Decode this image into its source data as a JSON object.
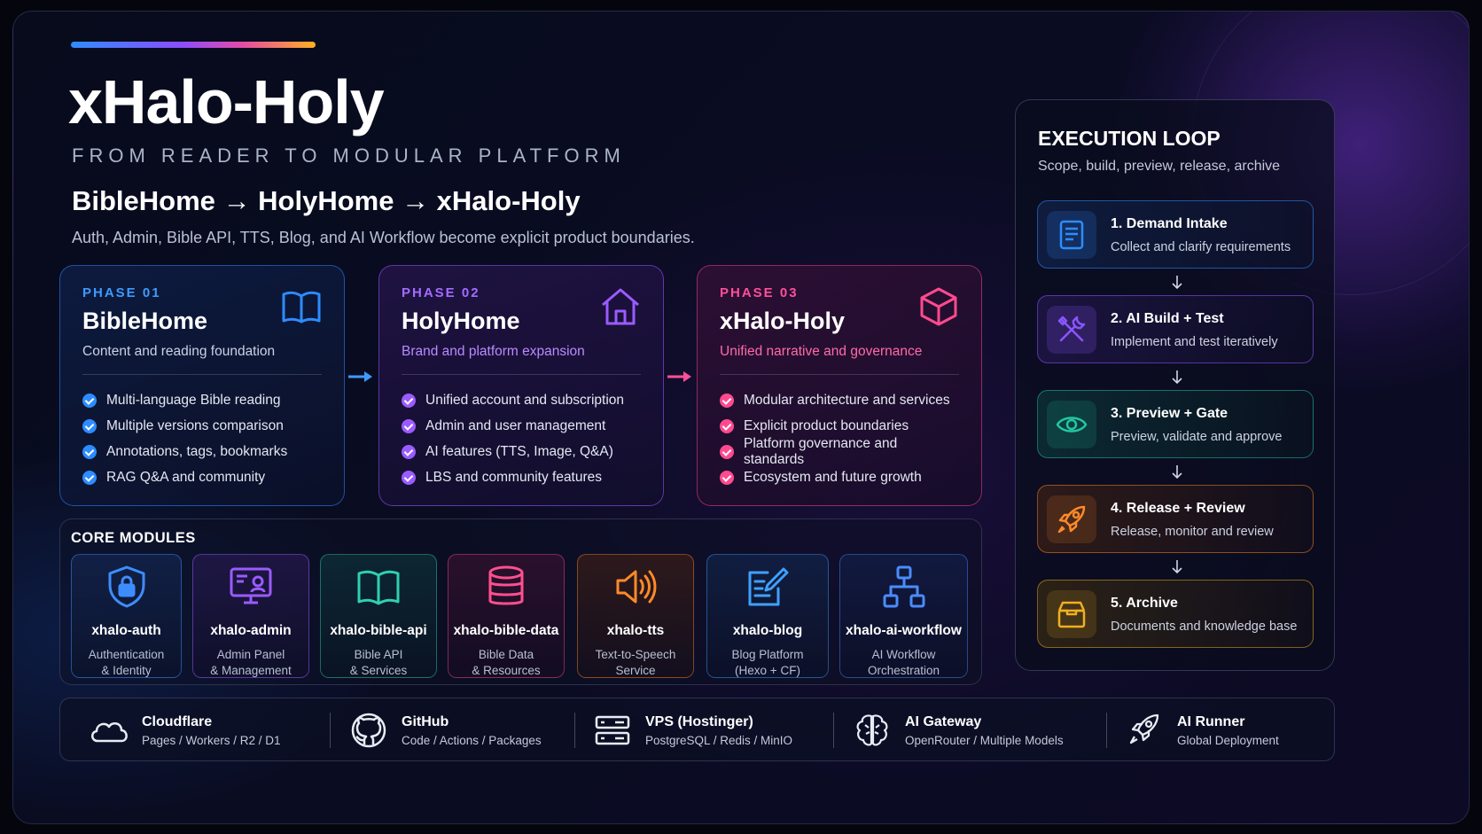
{
  "header": {
    "title": "xHalo-Holy",
    "subtitle": "FROM READER TO MODULAR PLATFORM",
    "flow": "BibleHome → HolyHome → xHalo-Holy",
    "description": "Auth, Admin, Bible API, TTS, Blog, and AI Workflow become explicit product boundaries."
  },
  "phases": [
    {
      "tag": "PHASE 01",
      "name": "BibleHome",
      "subtitle": "Content and reading foundation",
      "icon": "open-book-icon",
      "color": "#2d8cff",
      "items": [
        "Multi-language Bible reading",
        "Multiple versions comparison",
        "Annotations, tags, bookmarks",
        "RAG Q&A and community"
      ]
    },
    {
      "tag": "PHASE 02",
      "name": "HolyHome",
      "subtitle": "Brand and platform expansion",
      "icon": "house-icon",
      "color": "#9a5bff",
      "items": [
        "Unified account and subscription",
        "Admin and user management",
        "AI features (TTS, Image, Q&A)",
        "LBS and community features"
      ]
    },
    {
      "tag": "PHASE 03",
      "name": "xHalo-Holy",
      "subtitle": "Unified narrative and governance",
      "icon": "cube-icon",
      "color": "#ff4a8f",
      "items": [
        "Modular architecture and services",
        "Explicit product boundaries",
        "Platform governance and standards",
        "Ecosystem and future growth"
      ]
    }
  ],
  "core_modules": {
    "title": "CORE MODULES",
    "modules": [
      {
        "name": "xhalo-auth",
        "desc": "Authentication\n& Identity",
        "icon": "shield-lock-icon",
        "color": "#3d8dff"
      },
      {
        "name": "xhalo-admin",
        "desc": "Admin Panel\n& Management",
        "icon": "admin-panel-icon",
        "color": "#9a5bff"
      },
      {
        "name": "xhalo-bible-api",
        "desc": "Bible API\n& Services",
        "icon": "open-book-icon",
        "color": "#2fd0b0"
      },
      {
        "name": "xhalo-bible-data",
        "desc": "Bible Data\n& Resources",
        "icon": "database-icon",
        "color": "#ff4f8f"
      },
      {
        "name": "xhalo-tts",
        "desc": "Text-to-Speech\nService",
        "icon": "speaker-icon",
        "color": "#ff8a2a"
      },
      {
        "name": "xhalo-blog",
        "desc": "Blog Platform\n(Hexo + CF)",
        "icon": "edit-icon",
        "color": "#3fa0ff"
      },
      {
        "name": "xhalo-ai-workflow",
        "desc": "AI Workflow\nOrchestration",
        "icon": "workflow-icon",
        "color": "#4a8cff"
      }
    ]
  },
  "execution_loop": {
    "title": "EXECUTION LOOP",
    "subtitle": "Scope, build, preview, release, archive",
    "steps": [
      {
        "title": "1. Demand Intake",
        "desc": "Collect and clarify requirements",
        "icon": "document-icon",
        "color": "#2d8cff"
      },
      {
        "title": "2. AI Build + Test",
        "desc": "Implement and test iteratively",
        "icon": "tools-icon",
        "color": "#8a55ff"
      },
      {
        "title": "3. Preview + Gate",
        "desc": "Preview, validate and approve",
        "icon": "eye-icon",
        "color": "#22c7a0"
      },
      {
        "title": "4. Release + Review",
        "desc": "Release, monitor and review",
        "icon": "rocket-icon",
        "color": "#ff8a2a"
      },
      {
        "title": "5. Archive",
        "desc": "Documents and knowledge base",
        "icon": "archive-box-icon",
        "color": "#f0b020"
      }
    ]
  },
  "infrastructure": [
    {
      "name": "Cloudflare",
      "desc": "Pages / Workers / R2 / D1",
      "icon": "cloud-icon"
    },
    {
      "name": "GitHub",
      "desc": "Code / Actions / Packages",
      "icon": "github-icon"
    },
    {
      "name": "VPS (Hostinger)",
      "desc": "PostgreSQL / Redis / MinIO",
      "icon": "server-icon"
    },
    {
      "name": "AI Gateway",
      "desc": "OpenRouter / Multiple Models",
      "icon": "brain-icon"
    },
    {
      "name": "AI Runner",
      "desc": "Global Deployment",
      "icon": "rocket-icon"
    }
  ]
}
